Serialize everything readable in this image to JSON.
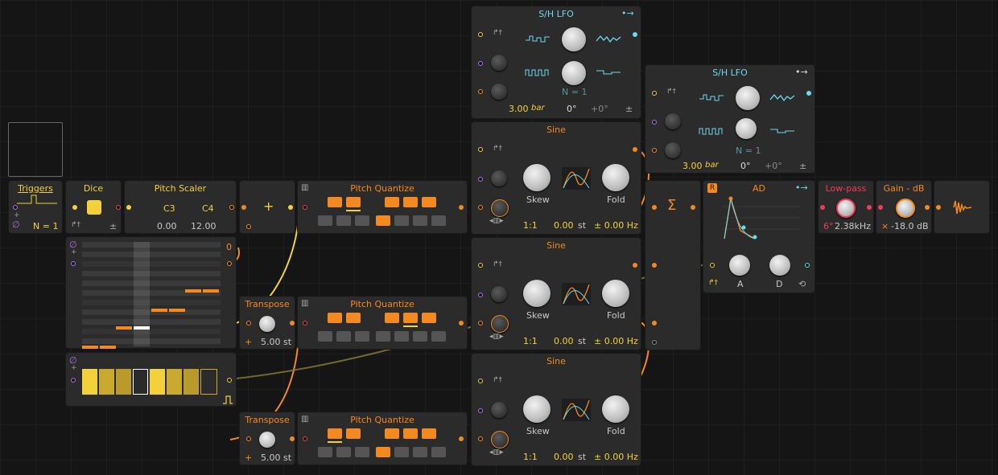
{
  "modules": {
    "triggers": {
      "title": "Triggers",
      "count": "N = 1"
    },
    "dice": {
      "title": "Dice"
    },
    "pitch_scaler": {
      "title": "Pitch Scaler",
      "low_note": "C3",
      "high_note": "C4",
      "low_value": "0.00",
      "high_value": "12.00"
    },
    "adder": {
      "symbol": "+",
      "offset": "0"
    },
    "pitch_quantize": {
      "title": "Pitch Quantize"
    },
    "transpose_1": {
      "title": "Transpose",
      "value": "5.00",
      "unit": "st",
      "sign": "+"
    },
    "transpose_2": {
      "title": "Transpose",
      "value": "5.00",
      "unit": "st",
      "sign": "+"
    },
    "sh_lfo_1": {
      "title": "S/H LFO",
      "count": "N = 1",
      "rate": "3.00",
      "rate_unit": "bar",
      "phase": "0°",
      "offset": "+0°",
      "pm": "±"
    },
    "sh_lfo_2": {
      "title": "S/H LFO",
      "count": "N = 1",
      "rate": "3.00",
      "rate_unit": "bar",
      "phase": "0°",
      "offset": "+0°",
      "pm": "±"
    },
    "sine": {
      "title": "Sine",
      "skew_label": "Skew",
      "fold_label": "Fold",
      "ratio": "1:1",
      "semitones": "0.00",
      "st_unit": "st",
      "freq": "± 0.00 Hz"
    },
    "mixer": {
      "symbol": "Σ"
    },
    "ad": {
      "title": "AD",
      "badge": "R",
      "attack_label": "A",
      "decay_label": "D"
    },
    "lowpass": {
      "title": "Low-pass",
      "slope": "6°",
      "cutoff": "2.38kHz"
    },
    "gain": {
      "title": "Gain - dB",
      "prefix": "×",
      "value": "-18.0 dB"
    }
  },
  "colors": {
    "yellow": "#f3d13a",
    "orange": "#f48a1f",
    "cyan": "#6fd8ec",
    "red": "#ef3d55",
    "violet": "#b06ee8"
  }
}
